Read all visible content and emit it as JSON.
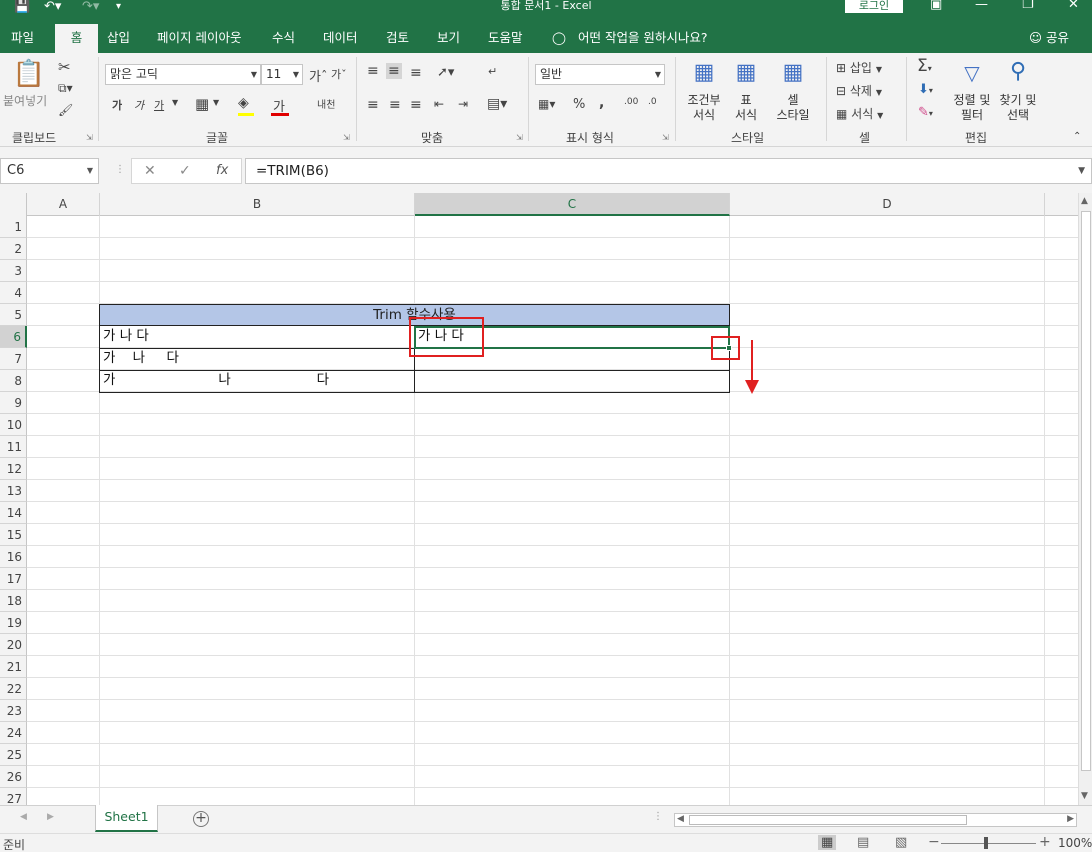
{
  "app": {
    "title": "통합 문서1  -  Excel",
    "login_label": "로그인",
    "window_controls": [
      "restore-icon",
      "minimize-icon",
      "maximize-icon",
      "close-icon"
    ]
  },
  "tabs": [
    {
      "label": "파일"
    },
    {
      "label": "홈"
    },
    {
      "label": "삽입"
    },
    {
      "label": "페이지 레이아웃"
    },
    {
      "label": "수식"
    },
    {
      "label": "데이터"
    },
    {
      "label": "검토"
    },
    {
      "label": "보기"
    },
    {
      "label": "도움말"
    }
  ],
  "tellme": "어떤 작업을 원하시나요?",
  "share": "공유",
  "ribbon": {
    "clipboard": {
      "paste": "붙여넣기",
      "label": "클립보드"
    },
    "font": {
      "name": "맑은 고딕",
      "size": "11",
      "label": "글꼴",
      "bold": "가",
      "italic": "가",
      "underline": "가",
      "color_letter": "가",
      "phonetic": "내천"
    },
    "alignment": {
      "label": "맞춤"
    },
    "number": {
      "format": "일반",
      "label": "표시 형식"
    },
    "styles": {
      "cond_1": "조건부",
      "cond_2": "서식",
      "table_1": "표",
      "table_2": "서식",
      "cell_1": "셀",
      "cell_2": "스타일",
      "label": "스타일"
    },
    "cells": {
      "insert": "삽입",
      "delete": "삭제",
      "format": "서식",
      "label": "셀"
    },
    "editing": {
      "sort_1": "정렬 및",
      "sort_2": "필터",
      "find_1": "찾기 및",
      "find_2": "선택",
      "label": "편집"
    }
  },
  "formula_bar": {
    "name_box": "C6",
    "formula": "=TRIM(B6)"
  },
  "columns": [
    "A",
    "B",
    "C",
    "D"
  ],
  "rows": [
    "1",
    "2",
    "3",
    "4",
    "5",
    "6",
    "7",
    "8",
    "9",
    "10",
    "11",
    "12",
    "13",
    "14",
    "15",
    "16",
    "17",
    "18",
    "19",
    "20",
    "21",
    "22",
    "23",
    "24",
    "25",
    "26",
    "27"
  ],
  "sheet": {
    "title": "Trim 함수사용",
    "b6": "가 나 다",
    "b7": "가    나     다",
    "b8": "가                        나                    다",
    "c6": "가 나 다"
  },
  "sheet_tab": "Sheet1",
  "status": {
    "ready": "준비",
    "zoom": "100%"
  }
}
